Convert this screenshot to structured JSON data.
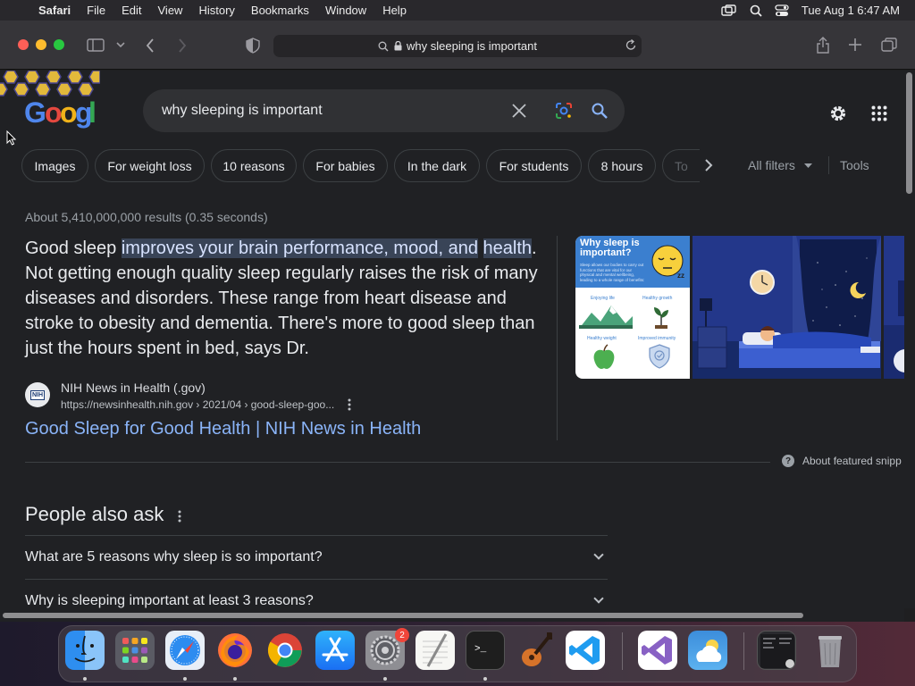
{
  "menubar": {
    "app_name": "Safari",
    "menus": [
      "File",
      "Edit",
      "View",
      "History",
      "Bookmarks",
      "Window",
      "Help"
    ],
    "clock": "Tue Aug 1  6:47 AM"
  },
  "browser": {
    "address": "why sleeping is important"
  },
  "google": {
    "query": "why sleeping is important",
    "chips": [
      "Images",
      "For weight loss",
      "10 reasons",
      "For babies",
      "In the dark",
      "For students",
      "8 hours",
      "To"
    ],
    "all_filters": "All filters",
    "tools": "Tools",
    "result_stats": "About 5,410,000,000 results (0.35 seconds)",
    "snippet_pre": "Good sleep ",
    "snippet_highlight_1": "improves your brain performance, mood, and",
    "snippet_highlight_2": "health",
    "snippet_post": ". Not getting enough quality sleep regularly raises the risk of many diseases and disorders. These range from heart disease and stroke to obesity and dementia. There's more to good sleep than just the hours spent in bed, says Dr.",
    "favicon_text": "NIH",
    "source_name": "NIH News in Health (.gov)",
    "source_url": "https://newsinhealth.nih.gov › 2021/04 › good-sleep-goo...",
    "result_title": "Good Sleep for Good Health | NIH News in Health",
    "about_snippets": "About featured snipp",
    "people_also_ask": "People also ask",
    "questions": [
      "What are 5 reasons why sleep is so important?",
      "Why is sleeping important at least 3 reasons?"
    ],
    "infographic": {
      "title_1": "Why sleep is",
      "title_2": "important?",
      "blurb": "Sleep allows our bodies to carry out functions that are vital for our physical and mental wellbeing, leading to a whole range of benefits:",
      "label_1": "Enjoying life",
      "label_2": "Healthy growth",
      "label_3": "Healthy weight",
      "label_4": "Improved immunity"
    }
  },
  "dock": {
    "badge": "2"
  },
  "colors": {
    "page_bg": "#202124",
    "link": "#8ab4f8",
    "highlight": "#394457"
  }
}
